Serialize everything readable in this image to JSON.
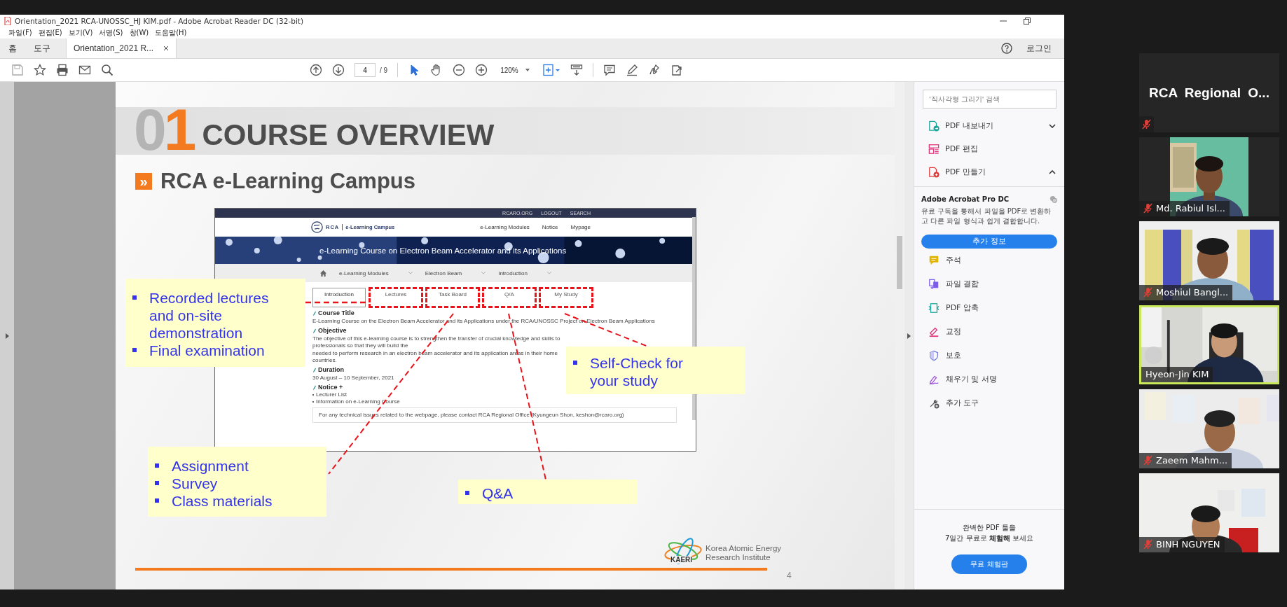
{
  "window": {
    "title": "Orientation_2021 RCA-UNOSSC_HJ KIM.pdf - Adobe Acrobat Reader DC (32-bit)"
  },
  "menu": [
    "파일(F)",
    "편집(E)",
    "보기(V)",
    "서명(S)",
    "창(W)",
    "도움말(H)"
  ],
  "tabs": [
    {
      "label": "홈",
      "kind": "nav",
      "selected": false
    },
    {
      "label": "도구",
      "kind": "nav",
      "selected": false
    },
    {
      "label": "Orientation_2021 R...",
      "kind": "document",
      "selected": true
    }
  ],
  "account": {
    "label": "로그인"
  },
  "toolbar": {
    "page": "4",
    "page_count": "/ 9",
    "zoom": "120%",
    "tools": [
      {
        "kind": "select",
        "selected": true
      },
      {
        "kind": "hand",
        "selected": false
      }
    ]
  },
  "slide": {
    "number_grey": "0",
    "number_accent": "1",
    "title": "COURSE OVERVIEW",
    "subtitle_marker": "»",
    "subtitle": "RCA e-Learning Campus",
    "page_number": "4",
    "logo": {
      "abbr": "KAERI",
      "name": [
        "Korea Atomic Energy",
        "Research Institute"
      ]
    },
    "website": {
      "top_links": [
        "RCARO.ORG",
        "LOGOUT",
        "SEARCH"
      ],
      "brand": "RCA",
      "brand_sub": "e-Learning Campus",
      "nav": [
        "e-Learning Modules",
        "Notice",
        "Mypage"
      ],
      "banner": "e-Learning Course on Electron Beam Accelerator and its Applications",
      "breadcrumb": [
        "e-Learning Modules",
        "Electron Beam",
        "Introduction"
      ],
      "tabs": [
        {
          "label": "Introduction",
          "selected": true,
          "highlighted": false
        },
        {
          "label": "Lectures",
          "selected": false,
          "highlighted": true
        },
        {
          "label": "Task Board",
          "selected": false,
          "highlighted": true
        },
        {
          "label": "Q/A",
          "selected": false,
          "highlighted": true
        },
        {
          "label": "My Study",
          "selected": false,
          "highlighted": true
        }
      ],
      "sections": [
        {
          "heading": "Course Title",
          "lines": [
            "E-Learning Course on the Electron Beam Accelerator and its Applications under the RCA/UNOSSC Project on Electron Beam Applications"
          ]
        },
        {
          "heading": "Objective",
          "lines": [
            "The objective of this e-learning course is to strengthen the transfer of crucial knowledge and skills to professionals so that they will build the",
            "needed to perform research in an electron beam accelerator and its application areas in their home countries."
          ]
        },
        {
          "heading": "Duration",
          "lines": [
            "30 August – 10 September, 2021"
          ]
        },
        {
          "heading": "Notice +",
          "items": [
            "Lecturer List",
            "Information on e-Learning Course"
          ]
        }
      ],
      "contact": "For any technical issues related to the webpage, please contact RCA Regional Office (Kyungeun Shon, keshon@rcaro.org)"
    },
    "callouts": [
      {
        "items": [
          "Recorded lectures and on-site demonstration",
          "Final examination"
        ]
      },
      {
        "items": [
          "Assignment",
          "Survey",
          "Class materials"
        ]
      },
      {
        "items": [
          "Q&A"
        ]
      },
      {
        "items": [
          "Self-Check for your study"
        ]
      }
    ]
  },
  "panel": {
    "search": {
      "placeholder": "'직사각형 그리기' 검색"
    },
    "groups": [
      {
        "label": "PDF 내보내기",
        "kind": "export",
        "expanded": false
      },
      {
        "label": "PDF 편집",
        "kind": "edit"
      },
      {
        "label": "PDF 만들기",
        "kind": "create",
        "expanded": true
      }
    ],
    "promo": {
      "title": "Adobe Acrobat Pro DC",
      "text": "유료 구독을 통해서 파일을 PDF로 변환하고 다른 파일 형식과 쉽게 결합합니다.",
      "button": "추가 정보"
    },
    "tools": [
      {
        "label": "주석",
        "kind": "comment"
      },
      {
        "label": "파일 결합",
        "kind": "combine"
      },
      {
        "label": "PDF 압축",
        "kind": "compress"
      },
      {
        "label": "교정",
        "kind": "redact"
      },
      {
        "label": "보호",
        "kind": "protect"
      },
      {
        "label": "채우기 및 서명",
        "kind": "sign"
      },
      {
        "label": "추가 도구",
        "kind": "more"
      }
    ],
    "trial": {
      "lines": [
        "완벽한 PDF 툴을",
        "7일간 무료로 **체험해** 보세요"
      ],
      "button": "무료 체험판"
    }
  },
  "participants": [
    {
      "name": "RCA Regional O...",
      "kind": "name_only",
      "muted": true,
      "speaking": false
    },
    {
      "name": "Md. Rabiul Isl...",
      "kind": "portrait_video",
      "muted": true,
      "speaking": false
    },
    {
      "name": "Moshiul Bangl...",
      "kind": "video",
      "muted": true,
      "speaking": false
    },
    {
      "name": "Hyeon-Jin KIM",
      "kind": "video",
      "muted": false,
      "speaking": true
    },
    {
      "name": "Zaeem Mahm...",
      "kind": "video",
      "muted": true,
      "speaking": false
    },
    {
      "name": "BINH NGUYEN",
      "kind": "video",
      "muted": true,
      "speaking": false
    }
  ]
}
